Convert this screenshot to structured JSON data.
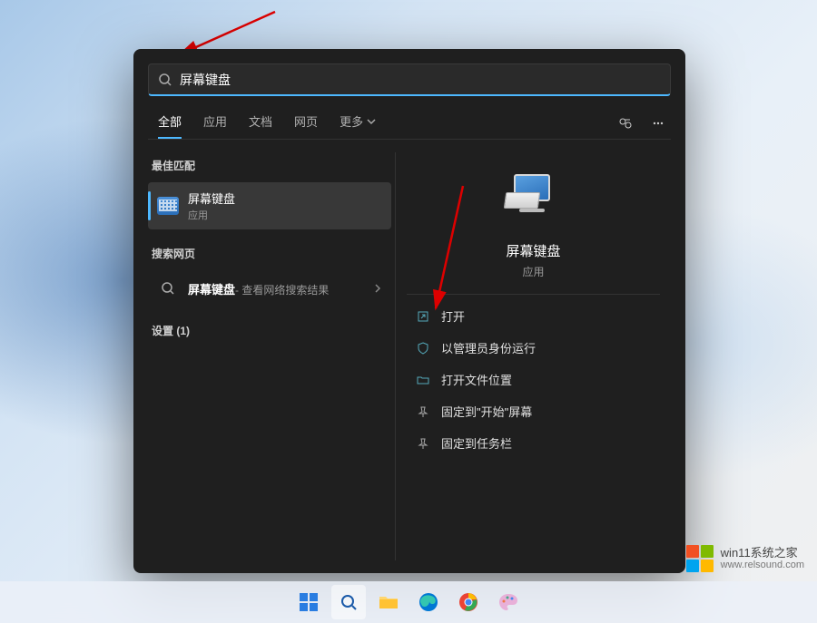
{
  "search": {
    "query": "屏幕键盘"
  },
  "tabs": {
    "items": [
      "全部",
      "应用",
      "文档",
      "网页",
      "更多"
    ]
  },
  "left": {
    "bestMatchHeader": "最佳匹配",
    "bestMatch": {
      "title": "屏幕键盘",
      "subtitle": "应用"
    },
    "webHeader": "搜索网页",
    "webItem": {
      "title": "屏幕键盘",
      "suffix": " - 查看网络搜索结果"
    },
    "settingsHeader": "设置 (1)"
  },
  "preview": {
    "title": "屏幕键盘",
    "subtitle": "应用",
    "actions": [
      "打开",
      "以管理员身份运行",
      "打开文件位置",
      "固定到\"开始\"屏幕",
      "固定到任务栏"
    ]
  },
  "watermark": {
    "line1": "win11系统之家",
    "line2": "www.relsound.com"
  }
}
